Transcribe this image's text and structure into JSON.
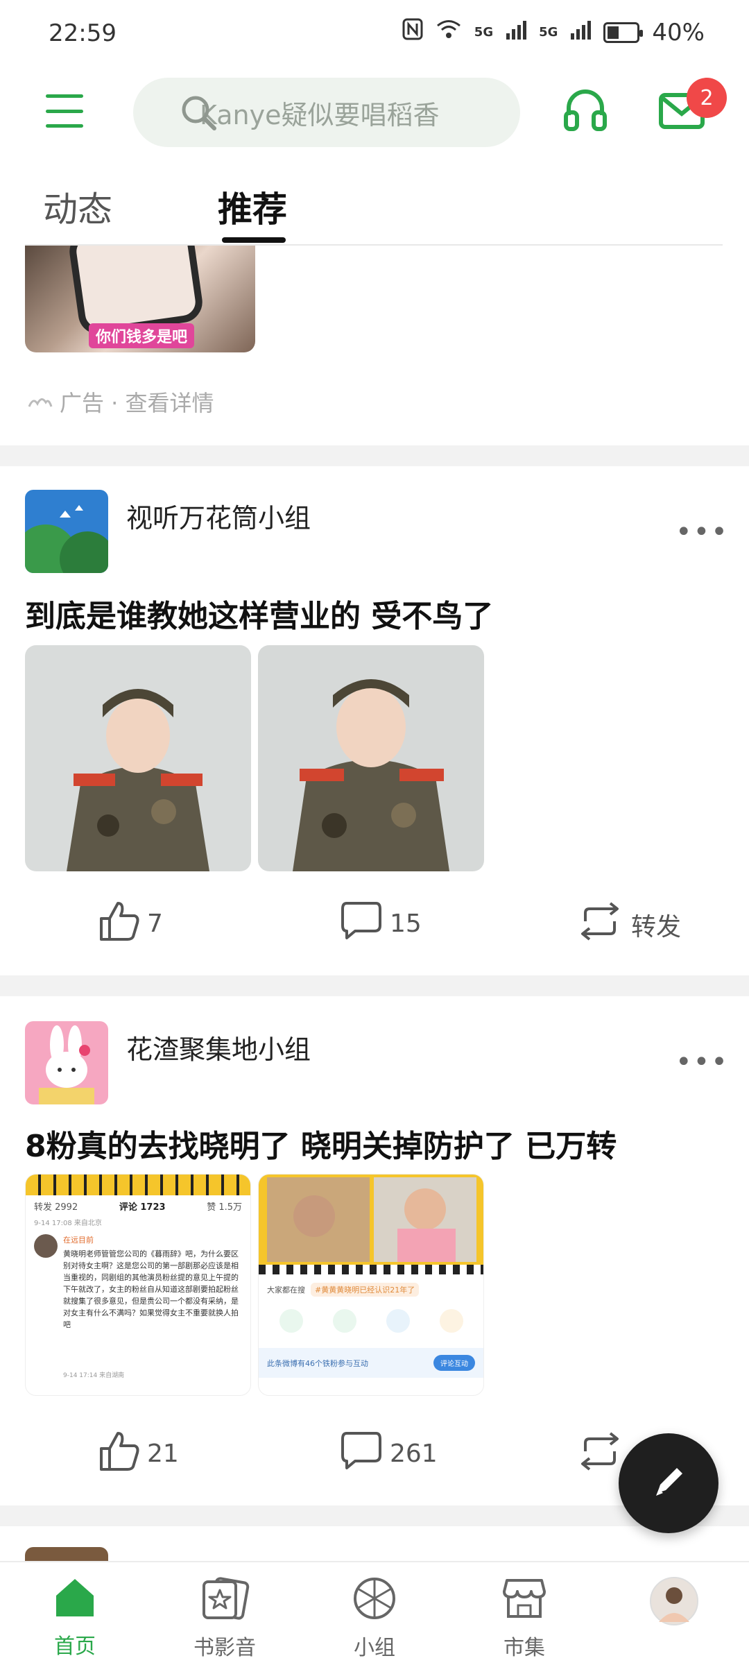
{
  "status_bar": {
    "time": "22:59",
    "network1": "5G",
    "network2": "5G",
    "battery": "40%",
    "battery_level": 0.4
  },
  "header": {
    "search_placeholder": "Kanye疑似要唱稻香",
    "mail_badge": "2"
  },
  "tabs": [
    {
      "label": "动态"
    },
    {
      "label": "推荐"
    }
  ],
  "ad": {
    "caption": "你们钱多是吧",
    "label": "广告 · 查看详情"
  },
  "posts": [
    {
      "group": "视听万花筒小组",
      "title": "到底是谁教她这样营业的  受不鸟了",
      "actions": {
        "likes": "7",
        "comments": "15",
        "share": "转发"
      }
    },
    {
      "group": "花渣聚集地小组",
      "title": "8粉真的去找晓明了  晓明关掉防护了  已万转",
      "shot1": {
        "repost": "转发 2992",
        "comments": "评论 1723",
        "likes": "赞 1.5万",
        "meta_top": "9-14 17:08 来自北京",
        "commenter": "在远目前",
        "body": "黄晓明老师管管您公司的《暮雨辞》吧，为什么要区别对待女主啊？这是您公司的第一部剧那必应该是相当重视的，同剧组的其他演员粉丝提的意见上午提的下午就改了，女主的粉丝自从知道这部剧要拍起粉丝就搜集了很多意见，但是贵公司一个都没有采纳，是对女主有什么不满吗？如果觉得女主不重要就换人拍吧",
        "meta_bottom": "9-14 17:14 来自湖南"
      },
      "shot2": {
        "trend_label": "大家都在搜",
        "trend_tag": "#黄黄黄晓明已经认识21年了",
        "banner": "此条微博有46个铁粉参与互动",
        "banner_btn": "评论互动"
      },
      "actions": {
        "likes": "21",
        "comments": "261"
      }
    }
  ],
  "nav": [
    {
      "label": "首页"
    },
    {
      "label": "书影音"
    },
    {
      "label": "小组"
    },
    {
      "label": "市集"
    }
  ],
  "colors": {
    "brand_green": "#2aa84a",
    "badge_red": "#f04848",
    "separator": "#f2f2f2"
  }
}
